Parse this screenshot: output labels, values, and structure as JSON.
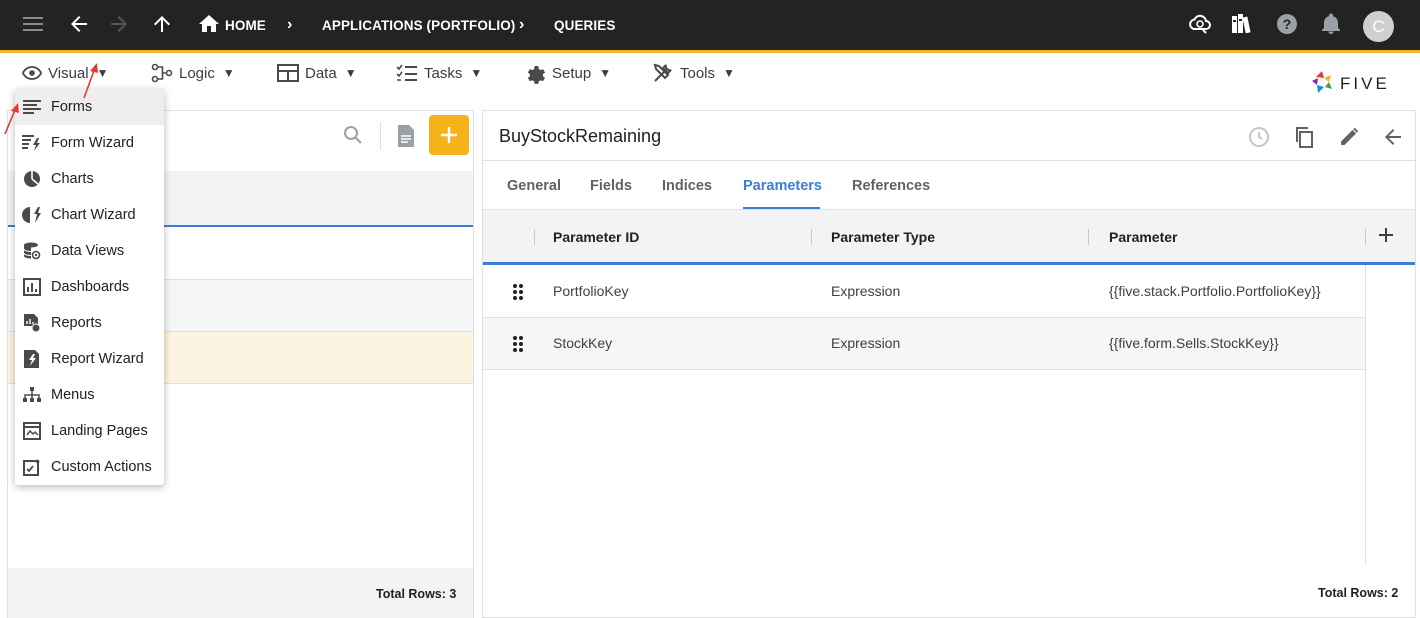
{
  "topbar": {
    "breadcrumbs": [
      "HOME",
      "APPLICATIONS (PORTFOLIO)",
      "QUERIES"
    ],
    "avatar_initial": "C",
    "icons": [
      "hamburger-icon",
      "back-arrow-icon",
      "forward-arrow-icon",
      "up-arrow-icon",
      "home-icon",
      "cloud-sync-icon",
      "library-icon",
      "help-icon",
      "bell-icon"
    ]
  },
  "menubar": {
    "items": [
      {
        "label": "Visual",
        "icon": "eye-icon"
      },
      {
        "label": "Logic",
        "icon": "logic-icon"
      },
      {
        "label": "Data",
        "icon": "table-icon"
      },
      {
        "label": "Tasks",
        "icon": "checklist-icon"
      },
      {
        "label": "Setup",
        "icon": "gear-icon"
      },
      {
        "label": "Tools",
        "icon": "tools-icon"
      }
    ],
    "logo_text": "FIVE"
  },
  "dropdown": {
    "items": [
      {
        "label": "Forms",
        "icon": "forms-icon"
      },
      {
        "label": "Form Wizard",
        "icon": "form-wizard-icon"
      },
      {
        "label": "Charts",
        "icon": "pie-chart-icon"
      },
      {
        "label": "Chart Wizard",
        "icon": "chart-wizard-icon"
      },
      {
        "label": "Data Views",
        "icon": "database-view-icon"
      },
      {
        "label": "Dashboards",
        "icon": "dashboard-icon"
      },
      {
        "label": "Reports",
        "icon": "report-icon"
      },
      {
        "label": "Report Wizard",
        "icon": "report-wizard-icon"
      },
      {
        "label": "Menus",
        "icon": "sitemap-icon"
      },
      {
        "label": "Landing Pages",
        "icon": "landing-page-icon"
      },
      {
        "label": "Custom Actions",
        "icon": "custom-action-icon"
      }
    ]
  },
  "left_panel": {
    "total_rows": "Total Rows: 3"
  },
  "right_panel": {
    "title": "BuyStockRemaining",
    "tabs": [
      "General",
      "Fields",
      "Indices",
      "Parameters",
      "References"
    ],
    "active_tab": "Parameters",
    "columns": [
      "Parameter ID",
      "Parameter Type",
      "Parameter"
    ],
    "rows": [
      {
        "id": "PortfolioKey",
        "type": "Expression",
        "param": "{{five.stack.Portfolio.PortfolioKey}}"
      },
      {
        "id": "StockKey",
        "type": "Expression",
        "param": "{{five.form.Sells.StockKey}}"
      }
    ],
    "total_rows": "Total Rows: 2"
  },
  "colors": {
    "appbar_bg": "#232323",
    "accent": "#f6b21a",
    "link_blue": "#3b7dd8",
    "selected_row": "#fdf3e1"
  }
}
